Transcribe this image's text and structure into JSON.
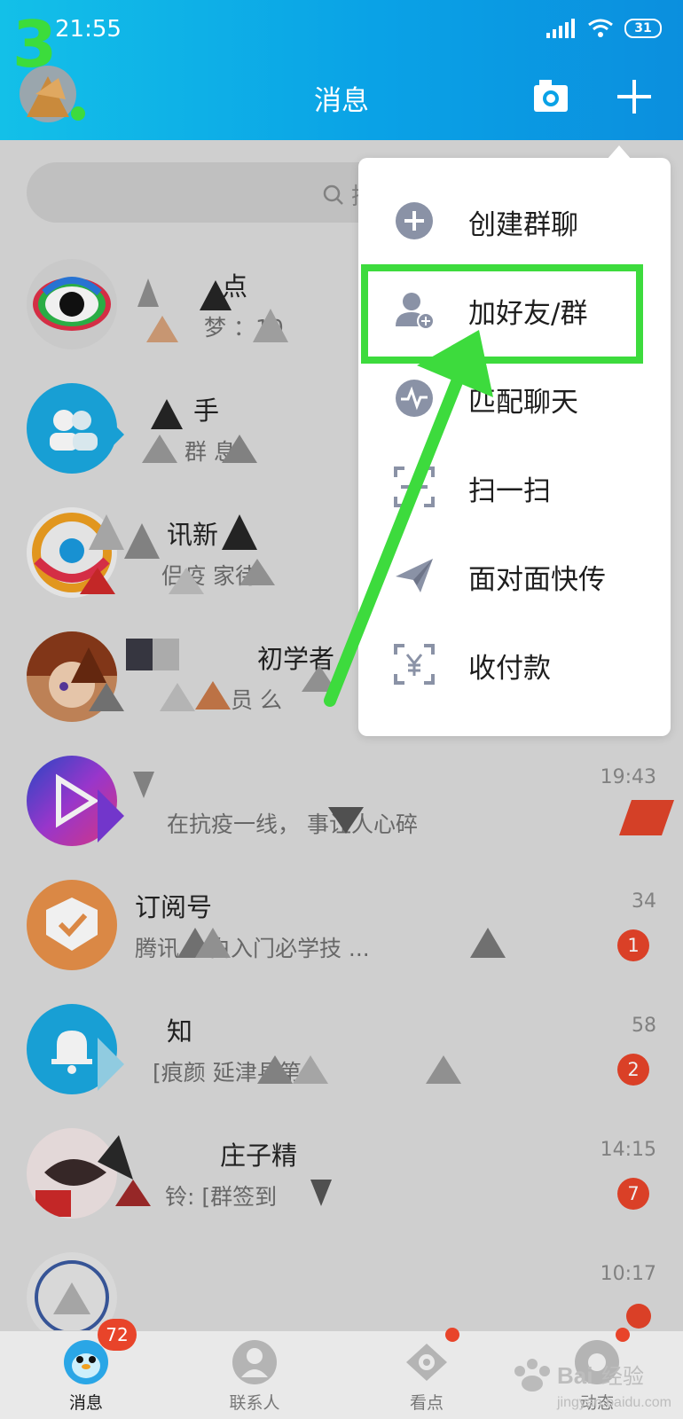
{
  "status": {
    "time": "21:55",
    "battery": "31"
  },
  "step_number": "3",
  "header": {
    "title": "消息"
  },
  "search": {
    "placeholder": "搜"
  },
  "conversations": [
    {
      "name": "点",
      "preview": "梦 ：10",
      "time": "",
      "badge": ""
    },
    {
      "name": "手",
      "preview": "群 息]",
      "time": "",
      "badge": ""
    },
    {
      "name": "讯新",
      "preview": "侣疫 家待",
      "time": "",
      "badge": ""
    },
    {
      "name": "初学者",
      "preview": "员 么",
      "time": "",
      "badge": ""
    },
    {
      "name": "",
      "preview": "在抗疫一线，  事让人心碎",
      "time": "19:43",
      "badge": ""
    },
    {
      "name": "订阅号",
      "preview": "腾讯 小白入门必学技 ...",
      "time": "34",
      "badge": "1"
    },
    {
      "name": "知",
      "preview": "[痕颜  延津县第",
      "time": "58",
      "badge": "2"
    },
    {
      "name": "庄子精",
      "preview": "铃: [群签到",
      "time": "14:15",
      "badge": "7"
    },
    {
      "name": "",
      "preview": "",
      "time": "10:17",
      "badge": ""
    }
  ],
  "popup_menu": {
    "items": [
      {
        "label": "创建群聊",
        "icon": "plus-circle-icon"
      },
      {
        "label": "加好友/群",
        "icon": "add-friend-icon"
      },
      {
        "label": "匹配聊天",
        "icon": "pulse-icon"
      },
      {
        "label": "扫一扫",
        "icon": "scan-icon"
      },
      {
        "label": "面对面快传",
        "icon": "send-icon"
      },
      {
        "label": "收付款",
        "icon": "payment-icon"
      }
    ],
    "highlighted_index": 1
  },
  "tabbar": {
    "tabs": [
      {
        "label": "消息",
        "badge": "72"
      },
      {
        "label": "联系人",
        "badge": ""
      },
      {
        "label": "看点",
        "badge": ""
      },
      {
        "label": "动态",
        "badge": ""
      }
    ]
  },
  "colors": {
    "header": "#0aa2e6",
    "highlight": "#3ddb3d",
    "badge": "#e8442a"
  }
}
